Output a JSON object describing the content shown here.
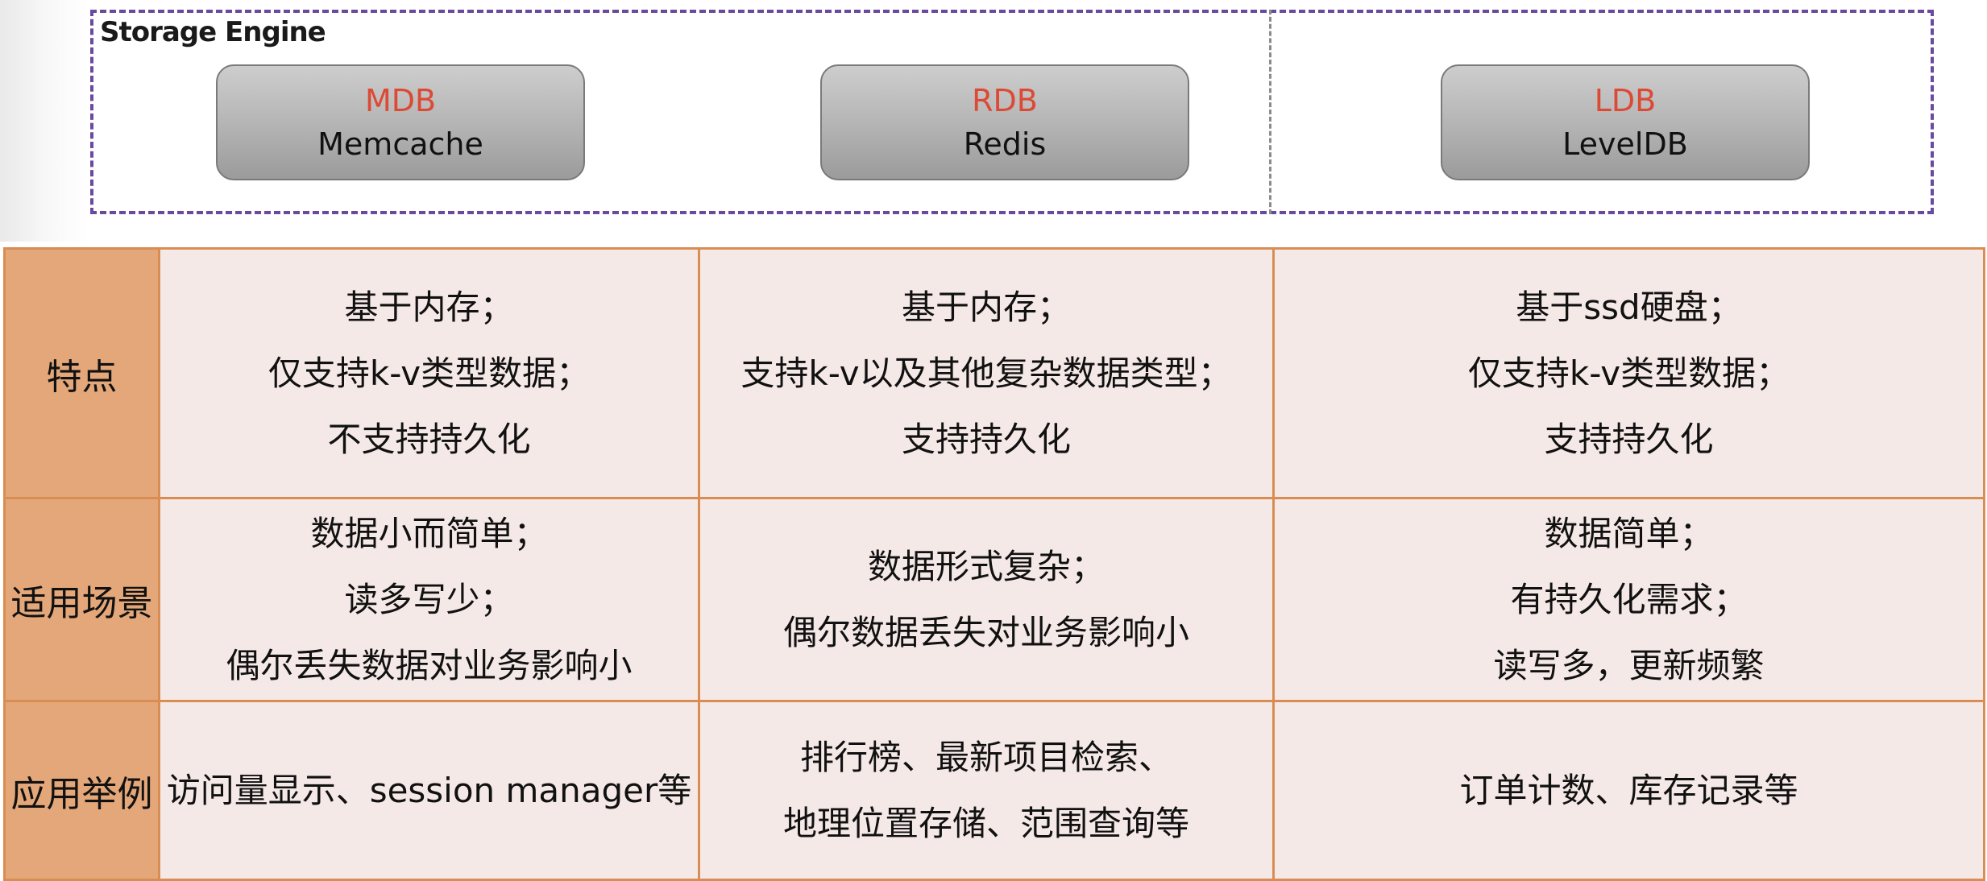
{
  "storage_engine": {
    "title": "Storage Engine",
    "engines": [
      {
        "abbr": "MDB",
        "name": "Memcache"
      },
      {
        "abbr": "RDB",
        "name": "Redis"
      },
      {
        "abbr": "LDB",
        "name": "LevelDB"
      }
    ]
  },
  "comparison_table": {
    "rows": [
      {
        "header": "特点",
        "cells": [
          [
            "基于内存；",
            "仅支持k-v类型数据；",
            "不支持持久化"
          ],
          [
            "基于内存；",
            "支持k-v以及其他复杂数据类型；",
            "支持持久化"
          ],
          [
            "基于ssd硬盘；",
            "仅支持k-v类型数据；",
            "支持持久化"
          ]
        ]
      },
      {
        "header": "适用场景",
        "cells": [
          [
            "数据小而简单；",
            "读多写少；",
            "偶尔丢失数据对业务影响小"
          ],
          [
            "数据形式复杂；",
            "偶尔数据丢失对业务影响小"
          ],
          [
            "数据简单；",
            "有持久化需求；",
            "读写多，更新频繁"
          ]
        ]
      },
      {
        "header": "应用举例",
        "cells": [
          [
            "访问量显示、session manager等"
          ],
          [
            "排行榜、最新项目检索、",
            "地理位置存储、范围查询等"
          ],
          [
            "订单计数、库存记录等"
          ]
        ]
      }
    ]
  },
  "colors": {
    "frame_border": "#6a4aa0",
    "engine_abbr": "#dc4a35",
    "table_border": "#d98d52",
    "row_header_bg": "#e3a779",
    "cell_bg": "#f5e9e7"
  }
}
